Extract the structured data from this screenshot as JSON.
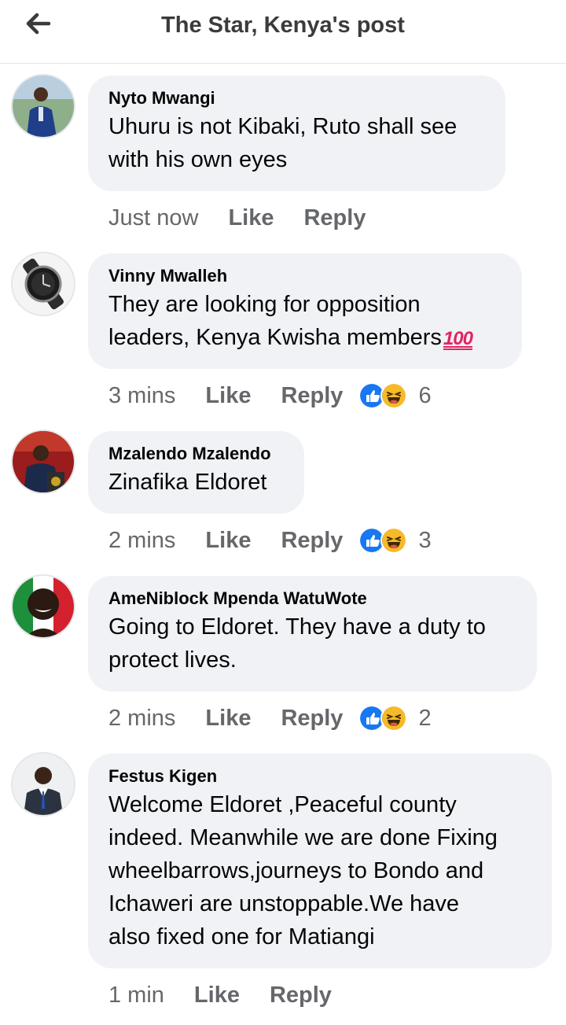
{
  "header": {
    "title": "The Star, Kenya's post",
    "back_icon": "arrow-left-icon"
  },
  "comments": [
    {
      "author": "Nyto Mwangi",
      "lines": [
        "Uhuru is not Kibaki, Ruto shall see",
        "with his own eyes"
      ],
      "time": "Just now",
      "like": "Like",
      "reply": "Reply"
    },
    {
      "author": "Vinny Mwalleh",
      "lines": [
        "They are looking for opposition",
        "leaders, Kenya Kwisha members"
      ],
      "emoji": "100",
      "time": "3 mins",
      "like": "Like",
      "reply": "Reply",
      "reaction_count": "6"
    },
    {
      "author": "Mzalendo Mzalendo",
      "lines": [
        "Zinafika Eldoret"
      ],
      "time": "2 mins",
      "like": "Like",
      "reply": "Reply",
      "reaction_count": "3"
    },
    {
      "author": "AmeNiblock Mpenda WatuWote",
      "lines": [
        "Going to Eldoret. They have a duty to",
        "protect lives."
      ],
      "time": "2 mins",
      "like": "Like",
      "reply": "Reply",
      "reaction_count": "2"
    },
    {
      "author": "Festus Kigen",
      "lines": [
        "Welcome Eldoret ,Peaceful county",
        "indeed. Meanwhile we are done Fixing",
        "wheelbarrows,journeys to Bondo and",
        "Ichaweri are unstoppable.We have",
        "also fixed one for Matiangi"
      ],
      "time": "1 min",
      "like": "Like",
      "reply": "Reply"
    }
  ],
  "colors": {
    "bubble": "#f0f2f5",
    "meta_text": "#65676b",
    "like_blue": "#1877f2",
    "haha_yellow": "#f7b928"
  },
  "icons": {
    "like_reaction": "thumbs-up-icon",
    "haha_reaction": "laughing-face-icon"
  }
}
